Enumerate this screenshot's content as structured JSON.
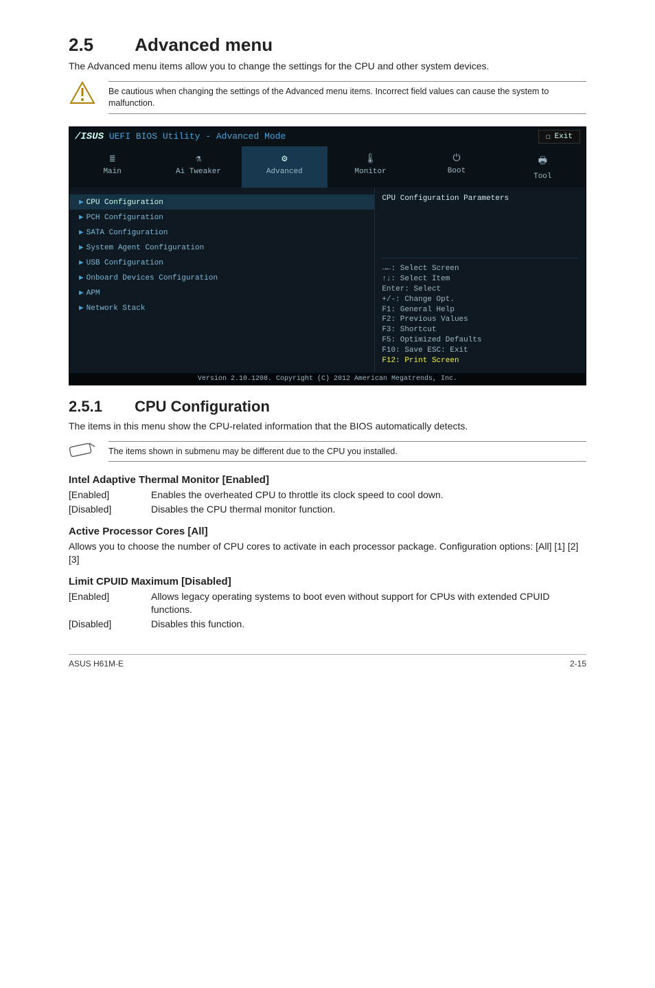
{
  "section": {
    "number": "2.5",
    "title": "Advanced menu"
  },
  "intro": "The Advanced menu items allow you to change the settings for the CPU and other system devices.",
  "caution": "Be cautious when changing the settings of the Advanced menu items. Incorrect field values can cause the system to malfunction.",
  "bios": {
    "brand": "/ISUS",
    "title_rest": "UEFI BIOS Utility - Advanced Mode",
    "exit": "Exit",
    "tabs": [
      {
        "icon": "≣",
        "label": "Main"
      },
      {
        "icon": "⚗",
        "label": "Ai Tweaker"
      },
      {
        "icon": "⚙",
        "label": "Advanced"
      },
      {
        "icon": "🌡",
        "label": "Monitor"
      },
      {
        "icon": "⏻",
        "label": "Boot"
      },
      {
        "icon": "🖶",
        "label": "Tool"
      }
    ],
    "active_tab": 2,
    "menu": [
      "CPU Configuration",
      "PCH Configuration",
      "SATA Configuration",
      "System Agent Configuration",
      "USB Configuration",
      "Onboard Devices Configuration",
      "APM",
      "Network Stack"
    ],
    "selected_menu": 0,
    "help_top": "CPU Configuration Parameters",
    "help_lines": [
      "→←: Select Screen",
      "↑↓: Select Item",
      "Enter: Select",
      "+/-: Change Opt.",
      "F1: General Help",
      "F2: Previous Values",
      "F3: Shortcut",
      "F5: Optimized Defaults",
      "F10: Save  ESC: Exit"
    ],
    "help_highlight": "F12: Print Screen",
    "footer": "Version 2.10.1208. Copyright (C) 2012 American Megatrends, Inc."
  },
  "subsection": {
    "number": "2.5.1",
    "title": "CPU Configuration"
  },
  "sub_intro": "The items in this menu show the CPU-related information that the BIOS automatically detects.",
  "sub_note": "The items shown in submenu may be different due to the CPU you installed.",
  "settings": [
    {
      "title": "Intel Adaptive Thermal Monitor [Enabled]",
      "options": [
        {
          "k": "[Enabled]",
          "v": "Enables the overheated CPU to throttle its clock speed to cool down."
        },
        {
          "k": "[Disabled]",
          "v": "Disables the CPU thermal monitor function."
        }
      ]
    },
    {
      "title": "Active Processor Cores [All]",
      "desc": "Allows you to choose the number of CPU cores to activate in each processor package. Configuration options: [All] [1] [2] [3]"
    },
    {
      "title": "Limit CPUID Maximum [Disabled]",
      "options": [
        {
          "k": "[Enabled]",
          "v": "Allows legacy operating systems to boot even without support for CPUs with extended CPUID functions."
        },
        {
          "k": "[Disabled]",
          "v": "Disables this function."
        }
      ]
    }
  ],
  "footer": {
    "left": "ASUS H61M-E",
    "right": "2-15"
  }
}
